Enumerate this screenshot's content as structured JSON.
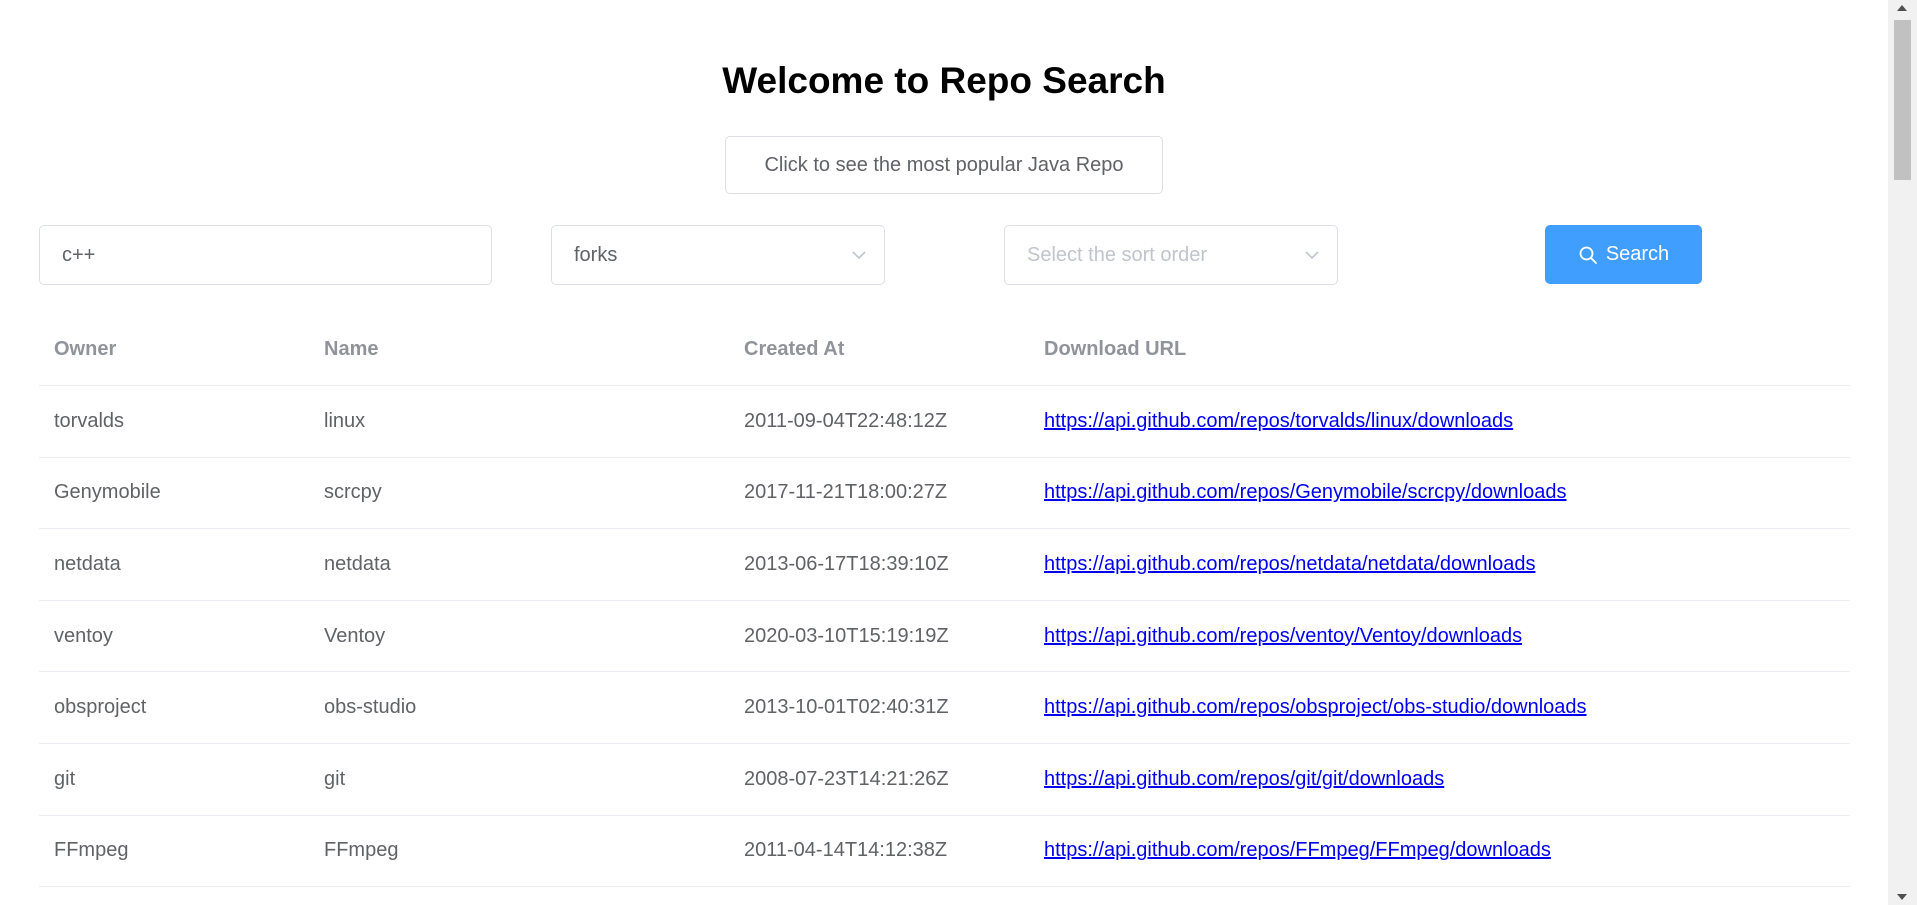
{
  "header": {
    "title": "Welcome to Repo Search",
    "popular_button_label": "Click to see the most popular Java Repo"
  },
  "search": {
    "query_value": "c++",
    "sort_field_value": "forks",
    "sort_order_placeholder": "Select the sort order",
    "search_button_label": "Search"
  },
  "table": {
    "columns": [
      "Owner",
      "Name",
      "Created At",
      "Download URL"
    ],
    "rows": [
      {
        "owner": "torvalds",
        "name": "linux",
        "created_at": "2011-09-04T22:48:12Z",
        "url": "https://api.github.com/repos/torvalds/linux/downloads"
      },
      {
        "owner": "Genymobile",
        "name": "scrcpy",
        "created_at": "2017-11-21T18:00:27Z",
        "url": "https://api.github.com/repos/Genymobile/scrcpy/downloads"
      },
      {
        "owner": "netdata",
        "name": "netdata",
        "created_at": "2013-06-17T18:39:10Z",
        "url": "https://api.github.com/repos/netdata/netdata/downloads"
      },
      {
        "owner": "ventoy",
        "name": "Ventoy",
        "created_at": "2020-03-10T15:19:19Z",
        "url": "https://api.github.com/repos/ventoy/Ventoy/downloads"
      },
      {
        "owner": "obsproject",
        "name": "obs-studio",
        "created_at": "2013-10-01T02:40:31Z",
        "url": "https://api.github.com/repos/obsproject/obs-studio/downloads"
      },
      {
        "owner": "git",
        "name": "git",
        "created_at": "2008-07-23T14:21:26Z",
        "url": "https://api.github.com/repos/git/git/downloads"
      },
      {
        "owner": "FFmpeg",
        "name": "FFmpeg",
        "created_at": "2011-04-14T14:12:38Z",
        "url": "https://api.github.com/repos/FFmpeg/FFmpeg/downloads"
      }
    ]
  },
  "colors": {
    "primary": "#409eff",
    "link": "#0000ee",
    "header_text": "#909399",
    "body_text": "#606266"
  }
}
